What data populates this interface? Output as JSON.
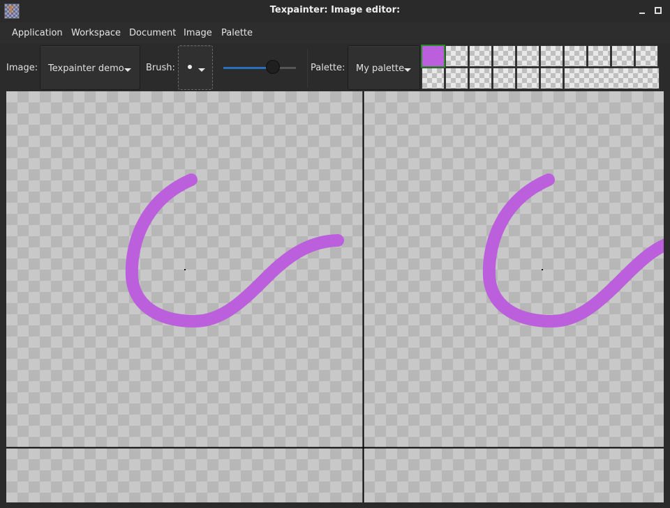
{
  "window": {
    "title": "Texpainter: Image editor:",
    "icon": "texpainter-app-icon",
    "icon_glyph": "T"
  },
  "menu": {
    "items": [
      "Application",
      "Workspace",
      "Document",
      "Image",
      "Palette"
    ]
  },
  "toolbar": {
    "image_label": "Image:",
    "image_value": "Texpainter demo",
    "brush_label": "Brush:",
    "brush_shape": "round-dot",
    "brush_size_fraction": 0.68,
    "palette_label": "Palette:",
    "palette_value": "My palette"
  },
  "palette": {
    "selected_index": 0,
    "colors": [
      "#bb5fdd"
    ],
    "swatch_count_row1": 10,
    "swatch_count_row2": 6
  },
  "colors": {
    "stroke": "#bb5fdd",
    "selection": "#2a8a2a",
    "slider_accent": "#2b6fc1",
    "checker_light": "#c8c8c8",
    "checker_dark": "#b7b7b7"
  },
  "canvas": {
    "background": "transparent-checkerboard",
    "tile_layout": "2x2 wrap-around preview"
  }
}
